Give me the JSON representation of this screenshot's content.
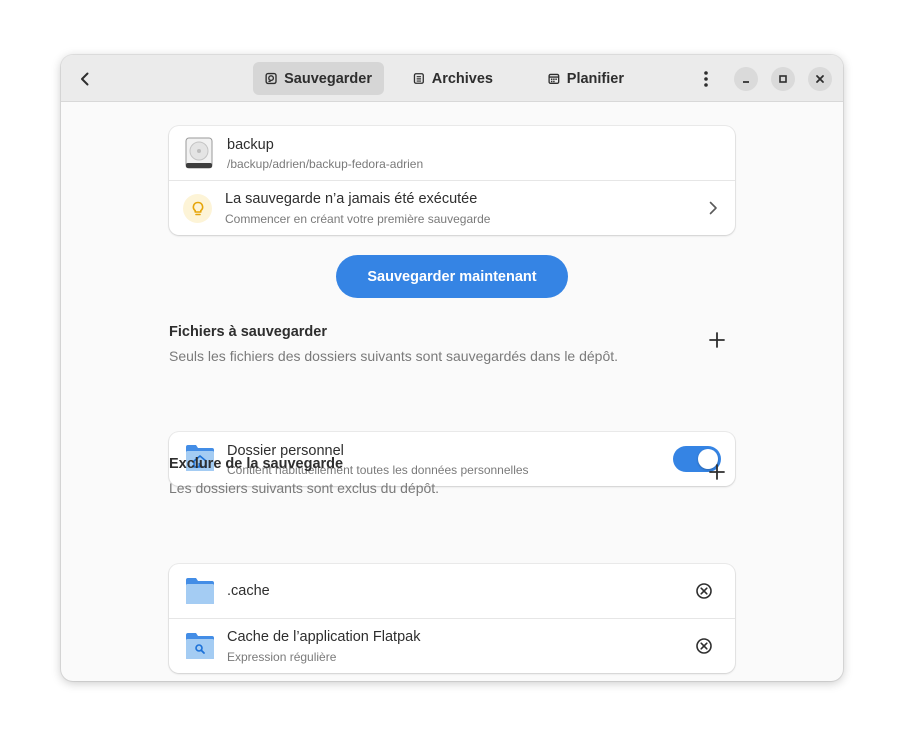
{
  "header": {
    "tabs": [
      {
        "label": "Sauvegarder",
        "icon": "drive-icon",
        "active": true
      },
      {
        "label": "Archives",
        "icon": "archive-icon",
        "active": false
      },
      {
        "label": "Planifier",
        "icon": "calendar-icon",
        "active": false
      }
    ]
  },
  "repository": {
    "name": "backup",
    "path": "/backup/adrien/backup-fedora-adrien",
    "status_title": "La sauvegarde n’a jamais été exécutée",
    "status_subtitle": "Commencer en créant votre première sauvegarde"
  },
  "backup_now_label": "Sauvegarder maintenant",
  "include": {
    "title": "Fichiers à sauvegarder",
    "description": "Seuls les fichiers des dossiers suivants sont sauvegardés dans le dépôt.",
    "items": [
      {
        "title": "Dossier personnel",
        "subtitle": "Contient habituellement toutes les données personnelles",
        "enabled": true
      }
    ]
  },
  "exclude": {
    "title": "Exclure de la sauvegarde",
    "description": "Les dossiers suivants sont exclus du dépôt.",
    "items": [
      {
        "title": ".cache",
        "subtitle": ""
      },
      {
        "title": "Cache de l’application Flatpak",
        "subtitle": "Expression régulière"
      }
    ]
  },
  "colors": {
    "accent": "#3584e4",
    "status_icon": "#e5a50a"
  }
}
